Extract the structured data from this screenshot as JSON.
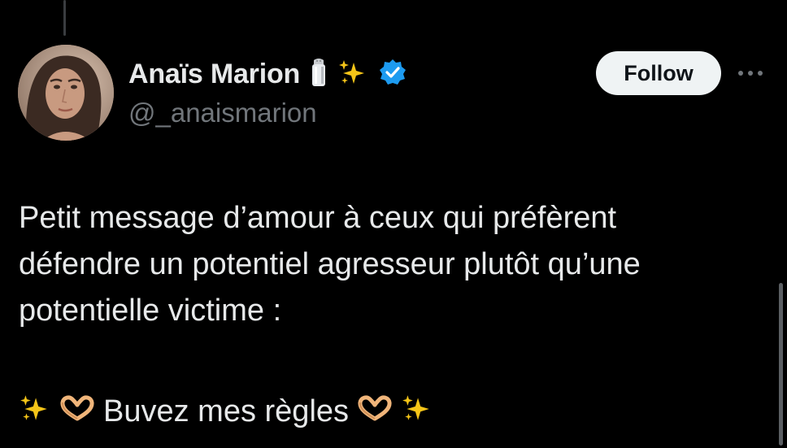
{
  "author": {
    "display_name": "Anaïs Marion",
    "handle": "@_anaismarion",
    "name_icons": [
      "salt-shaker-icon",
      "sparkles-icon",
      "verified-badge-icon"
    ]
  },
  "actions": {
    "follow_label": "Follow",
    "more_icon": "more-horizontal-icon"
  },
  "tweet": {
    "lines": [
      "Petit message d’amour à ceux qui préfèrent",
      "défendre un potentiel agresseur plutôt qu’une",
      "potentielle victime :"
    ],
    "closing_text": "Buvez mes règles",
    "closing_icons": [
      "sparkles-icon",
      "heart-hands-icon",
      "heart-hands-icon",
      "sparkles-icon"
    ]
  },
  "colors": {
    "background": "#000000",
    "text_primary": "#e7e9ea",
    "text_secondary": "#71767b",
    "verified_blue": "#1d9bf0",
    "follow_button_bg": "#eff3f4",
    "sparkle_yellow": "#f5c518"
  }
}
